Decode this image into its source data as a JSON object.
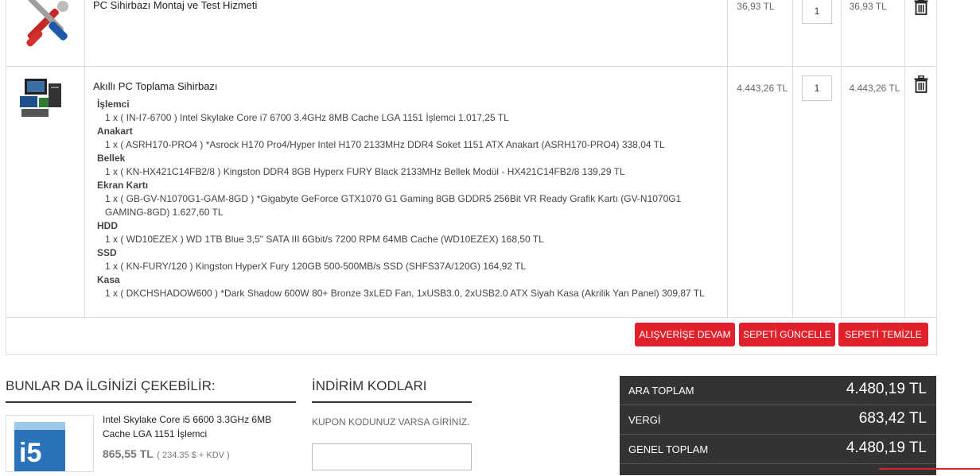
{
  "cart": {
    "items": [
      {
        "name": "PC Sihirbazı Montaj ve Test Hizmeti",
        "price": "36,93 TL",
        "qty": "1",
        "total": "36,93 TL",
        "icon": "tools-icon"
      },
      {
        "name": "Akıllı PC Toplama Sihirbazı",
        "price": "4.443,26 TL",
        "qty": "1",
        "total": "4.443,26 TL",
        "icon": "pc-bundle-icon",
        "options": [
          {
            "group": "İşlemci",
            "value": "1 x ( IN-I7-6700 ) Intel Skylake Core i7 6700 3.4GHz 8MB Cache LGA 1151 İşlemci 1.017,25 TL"
          },
          {
            "group": "Anakart",
            "value": "1 x ( ASRH170-PRO4 ) *Asrock H170 Pro4/Hyper Intel H170 2133MHz DDR4 Soket 1151 ATX Anakart (ASRH170-PRO4) 338,04 TL"
          },
          {
            "group": "Bellek",
            "value": "1 x ( KN-HX421C14FB2/8 ) Kingston DDR4 8GB Hyperx FURY Black 2133MHz Bellek Modül - HX421C14FB2/8 139,29 TL"
          },
          {
            "group": "Ekran Kartı",
            "value": "1 x ( GB-GV-N1070G1-GAM-8GD ) *Gigabyte GeForce GTX1070 G1 Gaming 8GB GDDR5 256Bit VR Ready Grafik Kartı (GV-N1070G1 GAMING-8GD) 1.627,60 TL"
          },
          {
            "group": "HDD",
            "value": "1 x ( WD10EZEX ) WD 1TB Blue 3,5\" SATA III 6Gbit/s 7200 RPM 64MB Cache (WD10EZEX) 168,50 TL"
          },
          {
            "group": "SSD",
            "value": "1 x ( KN-FURY/120 ) Kingston HyperX Fury 120GB 500-500MB/s SSD (SHFS37A/120G) 164,92 TL"
          },
          {
            "group": "Kasa",
            "value": "1 x ( DKCHSHADOW600 ) *Dark Shadow 600W 80+ Bronze 3xLED Fan, 1xUSB3.0, 2xUSB2.0 ATX Siyah Kasa (Akrilik Yan Panel) 309,87 TL"
          }
        ]
      }
    ],
    "buttons": {
      "continue": "ALIŞVERİŞE DEVAM",
      "update": "SEPETİ GÜNCELLE",
      "clear": "SEPETİ TEMİZLE"
    }
  },
  "related": {
    "title": "BUNLAR DA İLGİNİZİ ÇEKEBİLİR:",
    "product": {
      "name": "Intel Skylake Core i5 6600 3.3GHz 6MB Cache LGA 1151 İşlemci",
      "price": "865,55 TL",
      "price_note": "( 234.35 $ + KDV )"
    }
  },
  "discount": {
    "title": "İNDİRİM KODLARI",
    "hint": "KUPON KODUNUZ VARSA GİRİNİZ.",
    "value": ""
  },
  "totals": {
    "subtotal_label": "ARA TOPLAM",
    "subtotal": "4.480,19 TL",
    "tax_label": "VERGİ",
    "tax": "683,42 TL",
    "grand_label": "GENEL TOPLAM",
    "grand": "4.480,19 TL"
  },
  "colors": {
    "accent": "#e0202a",
    "panel": "#333333"
  }
}
